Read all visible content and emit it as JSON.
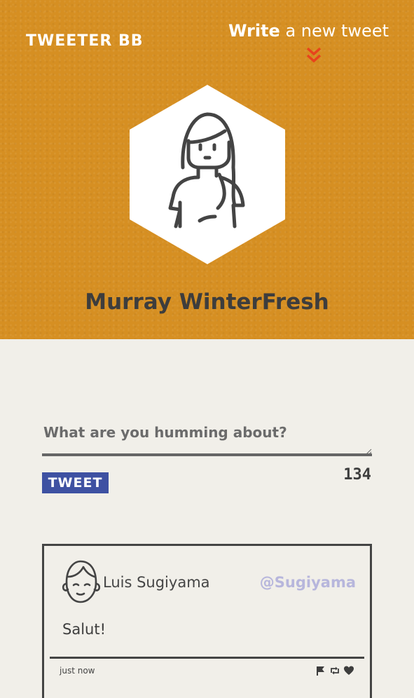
{
  "app": {
    "brand": "TWEETER BB"
  },
  "nav": {
    "write_strong": "Write",
    "write_rest": " a new tweet",
    "chevron_icon": "double-chevron-down-icon",
    "chevron_color": "#e8431c"
  },
  "profile": {
    "name": "Murray WinterFresh",
    "avatar_icon": "woman-avatar-icon",
    "header_color": "#d68f22"
  },
  "composer": {
    "placeholder": "What are you humming about?",
    "value": "",
    "button_label": "TWEET",
    "counter": "134",
    "button_color": "#3e51a2"
  },
  "tweets": [
    {
      "name": "Luis Sugiyama",
      "handle": "@Sugiyama",
      "text": "Salut!",
      "time": "just now",
      "avatar_icon": "man-avatar-icon",
      "actions": [
        "flag-icon",
        "retweet-icon",
        "heart-icon"
      ]
    }
  ],
  "colors": {
    "page_background": "#f1efe9",
    "handle": "#b7b6dc"
  }
}
